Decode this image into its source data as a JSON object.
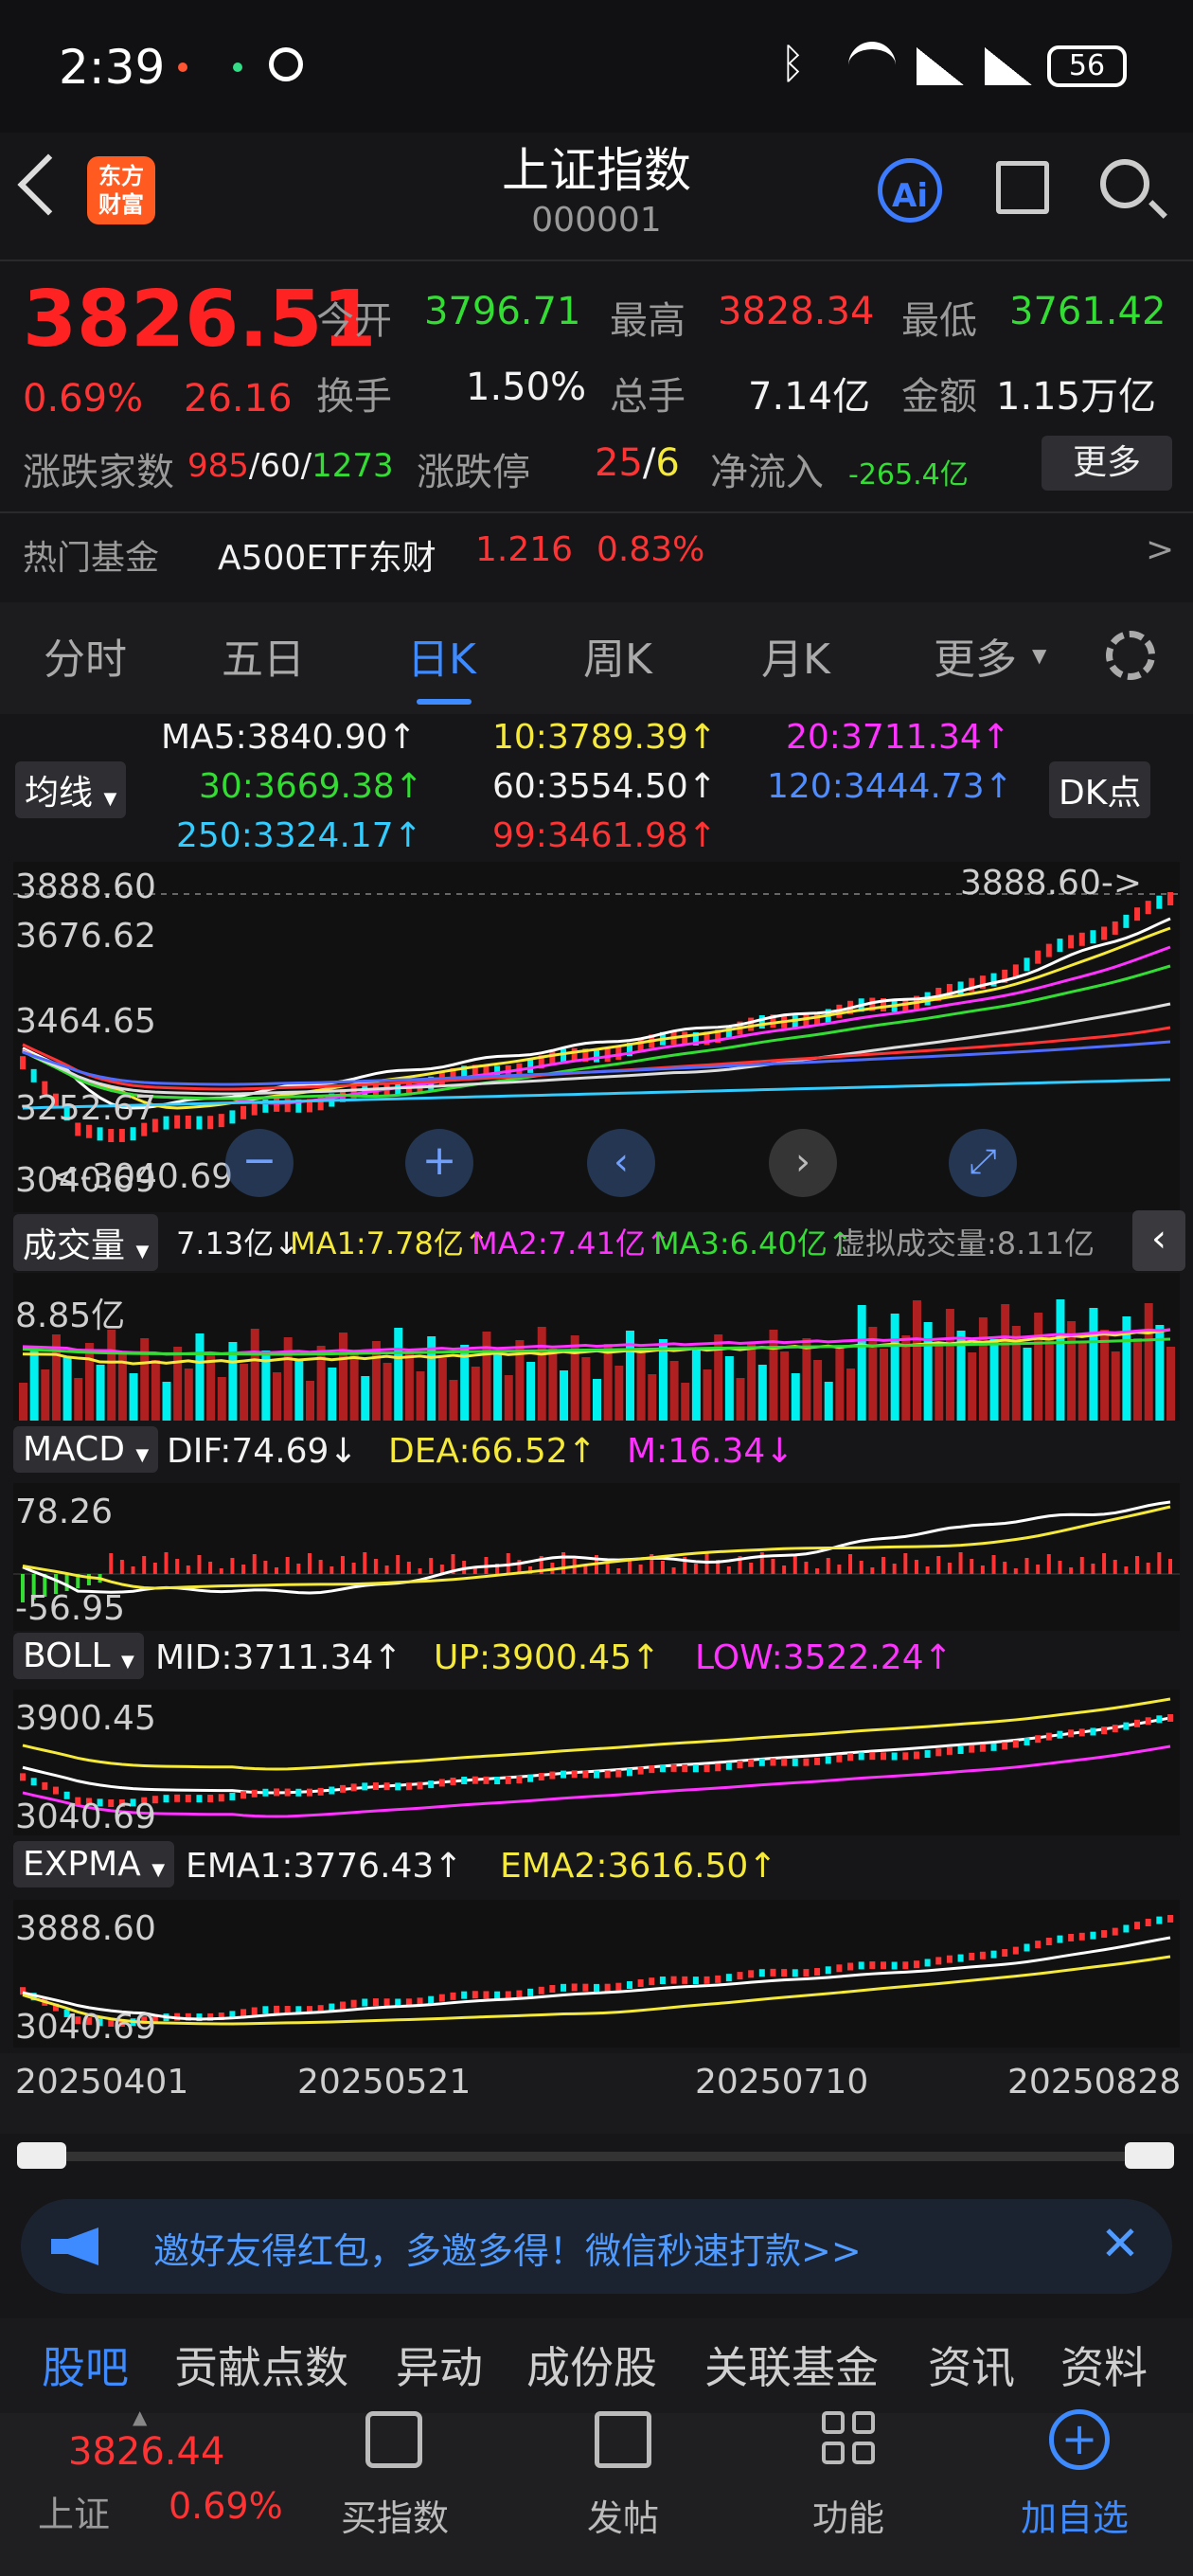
{
  "status": {
    "time": "2:39",
    "battery": "56"
  },
  "header": {
    "title": "上证指数",
    "code": "000001",
    "logo_line1": "东方",
    "logo_line2": "财富",
    "ai_label": "Ai"
  },
  "quote": {
    "price": "3826.51",
    "pct": "0.69%",
    "change": "26.16",
    "open_label": "今开",
    "open": "3796.71",
    "high_label": "最高",
    "high": "3828.34",
    "low_label": "最低",
    "low": "3761.42",
    "turnover_label": "换手",
    "turnover": "1.50%",
    "volume_label": "总手",
    "volume": "7.14亿",
    "amount_label": "金额",
    "amount": "1.15万亿",
    "breadth_label": "涨跌家数",
    "up": "985",
    "flat": "60",
    "down": "1273",
    "slash": "/",
    "limit_label": "涨跌停",
    "limit_up": "25",
    "limit_down": "6",
    "netflow_label": "净流入",
    "netflow": "-265.4亿",
    "more": "更多"
  },
  "fund": {
    "label": "热门基金",
    "name": "A500ETF东财",
    "price": "1.216",
    "pct": "0.83%",
    "arrow": ">"
  },
  "tabs": [
    "分时",
    "五日",
    "日K",
    "周K",
    "月K",
    "更多"
  ],
  "ma": {
    "selector": "均线",
    "dk": "DK点",
    "ma5": "MA5:3840.90↑",
    "ma10": "10:3789.39↑",
    "ma20": "20:3711.34↑",
    "ma30": "30:3669.38↑",
    "ma60": "60:3554.50↑",
    "ma120": "120:3444.73↑",
    "ma250": "250:3324.17↑",
    "ma99": "99:3461.98↑"
  },
  "kline": {
    "y1": "3888.60",
    "y2": "3676.62",
    "y3": "3464.65",
    "y4": "3252.67",
    "y5": "3040.69",
    "max_tag": "3888.60->",
    "min_tag": "<-3040.69"
  },
  "volume": {
    "selector": "成交量",
    "v": "7.13亿↓",
    "ma1": "MA1:7.78亿↑",
    "ma2": "MA2:7.41亿↑",
    "ma3": "MA3:6.40亿↑",
    "virtual": "虚拟成交量:8.11亿",
    "y": "8.85亿"
  },
  "macd": {
    "selector": "MACD",
    "dif": "DIF:74.69↓",
    "dea": "DEA:66.52↑",
    "m": "M:16.34↓",
    "y1": "78.26",
    "y2": "-56.95"
  },
  "boll": {
    "selector": "BOLL",
    "mid": "MID:3711.34↑",
    "up": "UP:3900.45↑",
    "low": "LOW:3522.24↑",
    "y1": "3900.45",
    "y2": "3040.69"
  },
  "expma": {
    "selector": "EXPMA",
    "ema1": "EMA1:3776.43↑",
    "ema2": "EMA2:3616.50↑",
    "y1": "3888.60",
    "y2": "3040.69"
  },
  "dates": [
    "20250401",
    "20250521",
    "20250710",
    "20250828"
  ],
  "banner": {
    "text": "邀好友得红包，多邀多得！微信秒速打款>>"
  },
  "bottom_tabs": [
    "股吧",
    "贡献点数",
    "异动",
    "成份股",
    "关联基金",
    "资讯",
    "资料"
  ],
  "footer": {
    "price": "3826.44",
    "name": "上证",
    "pct": "0.69%",
    "buy": "买指数",
    "post": "发帖",
    "func": "功能",
    "add": "加自选"
  },
  "colors": {
    "up": "#ff3333",
    "down": "#00f0f0",
    "accent": "#3d8bff",
    "ma5": "#ffffff",
    "ma10": "#f5e93b",
    "ma20": "#ff33ff",
    "ma30": "#33dd33",
    "ma60": "#dddddd",
    "ma120": "#4f6cff",
    "ma250": "#33ccff"
  }
}
